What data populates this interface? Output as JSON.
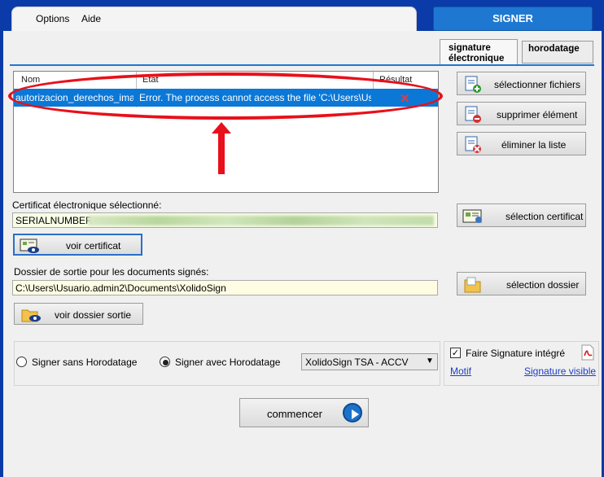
{
  "menu": {
    "options": "Options",
    "aide": "Aide"
  },
  "header": {
    "signer_tab": "SIGNER"
  },
  "tabs": {
    "signature": "signature\nélectronique",
    "signature_line1": "signature",
    "signature_line2": "électronique",
    "horodatage": "horodatage"
  },
  "file_list": {
    "columns": [
      "Nom",
      "Etat",
      "Résultat"
    ],
    "rows": [
      {
        "name": "autorizacion_derechos_ima...",
        "state": "Error. The process cannot access the file 'C:\\Users\\Usuar...",
        "result_icon": "red-x-icon"
      }
    ]
  },
  "side_buttons": {
    "select_files": "sélectionner fichiers",
    "delete_item": "supprimer élément",
    "clear_list": "éliminer la liste",
    "select_certificate": "sélection certificat",
    "select_folder": "sélection dossier"
  },
  "certificate": {
    "label": "Certificat électronique sélectionné:",
    "value_prefix": "SERIALNUMBER=",
    "view_button": "voir certificat"
  },
  "output": {
    "label": "Dossier de sortie pour les documents signés:",
    "path": "C:\\Users\\Usuario.admin2\\Documents\\XolidoSign",
    "view_button": "voir dossier sortie"
  },
  "options": {
    "no_timestamp": "Signer sans Horodatage",
    "with_timestamp": "Signer avec Horodatage",
    "selected": "with_timestamp",
    "tsa_selected": "XolidoSign TSA - ACCV"
  },
  "signature_options": {
    "embedded_label": "Faire Signature intégré",
    "embedded_checked": true,
    "motif_link": "Motif",
    "visible_link": "Signature visible"
  },
  "start_button": "commencer",
  "colors": {
    "accent": "#1e78d2",
    "selection": "#0b78d7",
    "annotation": "#e8101a"
  }
}
